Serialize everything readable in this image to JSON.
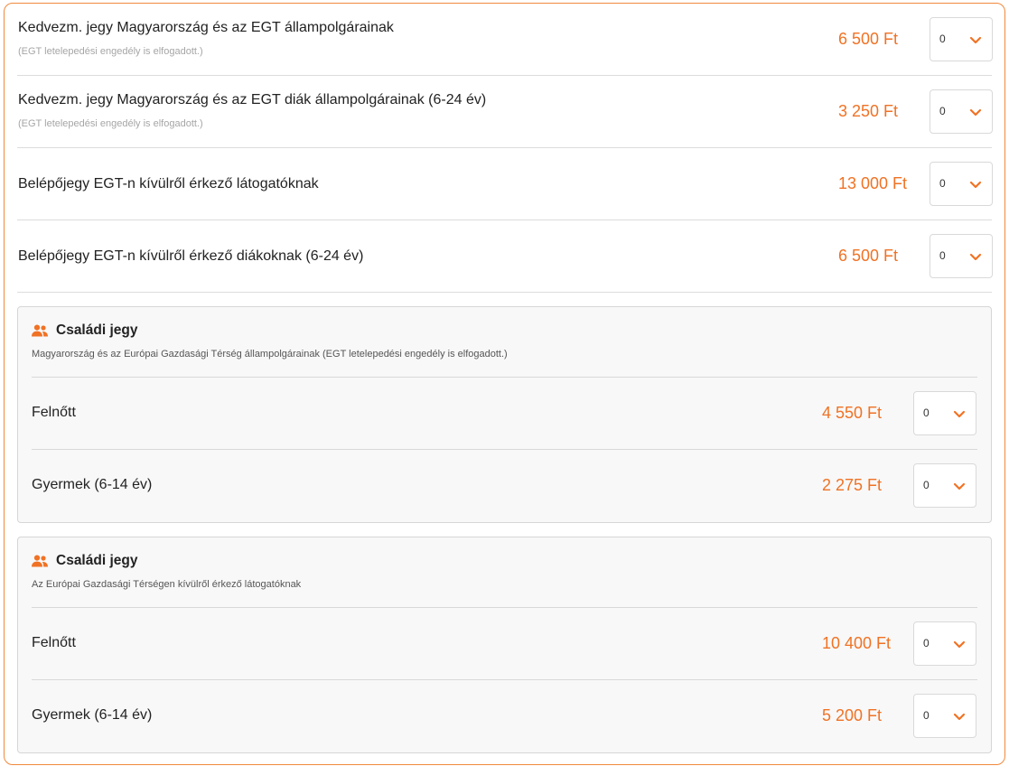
{
  "accent_color": "#f07224",
  "qty_chevron_icon": "chevron-down-icon",
  "family_icon": "users-icon",
  "tickets": [
    {
      "name": "Kedvezm. jegy Magyarország és az EGT állampolgárainak",
      "note": "(EGT letelepedési engedély is elfogadott.)",
      "price": "6 500 Ft",
      "quantity": "0"
    },
    {
      "name": "Kedvezm. jegy Magyarország és az EGT diák állampolgárainak (6-24 év)",
      "note": "(EGT letelepedési engedély is elfogadott.)",
      "price": "3 250 Ft",
      "quantity": "0"
    },
    {
      "name": "Belépőjegy EGT-n kívülről érkező látogatóknak",
      "price": "13 000 Ft",
      "quantity": "0"
    },
    {
      "name": "Belépőjegy EGT-n kívülről érkező diákoknak (6-24 év)",
      "price": "6 500 Ft",
      "quantity": "0"
    }
  ],
  "family_groups": [
    {
      "title": "Családi jegy",
      "description": "Magyarország és az Európai Gazdasági Térség állampolgárainak (EGT letelepedési engedély is elfogadott.)",
      "rows": [
        {
          "name": "Felnőtt",
          "price": "4 550 Ft",
          "quantity": "0"
        },
        {
          "name": "Gyermek (6-14 év)",
          "price": "2 275 Ft",
          "quantity": "0"
        }
      ]
    },
    {
      "title": "Családi jegy",
      "description": "Az Európai Gazdasági Térségen kívülről érkező látogatóknak",
      "rows": [
        {
          "name": "Felnőtt",
          "price": "10 400 Ft",
          "quantity": "0"
        },
        {
          "name": "Gyermek (6-14 év)",
          "price": "5 200 Ft",
          "quantity": "0"
        }
      ]
    }
  ]
}
